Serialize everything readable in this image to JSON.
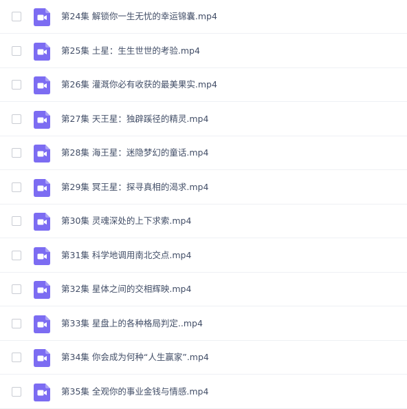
{
  "theme": {
    "icon_color": "#7c6cf2",
    "text_color": "#424e67"
  },
  "files": [
    {
      "name": "第24集 解锁你一生无忧的幸运锦囊.mp4",
      "icon": "video-file-icon"
    },
    {
      "name": "第25集 土星：生生世世的考验.mp4",
      "icon": "video-file-icon"
    },
    {
      "name": "第26集 灌溉你必有收获的最美果实.mp4",
      "icon": "video-file-icon"
    },
    {
      "name": "第27集 天王星：独辟蹊径的精灵.mp4",
      "icon": "video-file-icon"
    },
    {
      "name": "第28集 海王星：迷隐梦幻的童话.mp4",
      "icon": "video-file-icon"
    },
    {
      "name": "第29集 冥王星：探寻真相的渴求.mp4",
      "icon": "video-file-icon"
    },
    {
      "name": "第30集 灵魂深处的上下求索.mp4",
      "icon": "video-file-icon"
    },
    {
      "name": "第31集 科学地调用南北交点.mp4",
      "icon": "video-file-icon"
    },
    {
      "name": "第32集 星体之间的交相辉映.mp4",
      "icon": "video-file-icon"
    },
    {
      "name": "第33集 星盘上的各种格局判定..mp4",
      "icon": "video-file-icon"
    },
    {
      "name": "第34集 你会成为何种“人生赢家”.mp4",
      "icon": "video-file-icon"
    },
    {
      "name": "第35集 全观你的事业金钱与情感.mp4",
      "icon": "video-file-icon"
    }
  ]
}
